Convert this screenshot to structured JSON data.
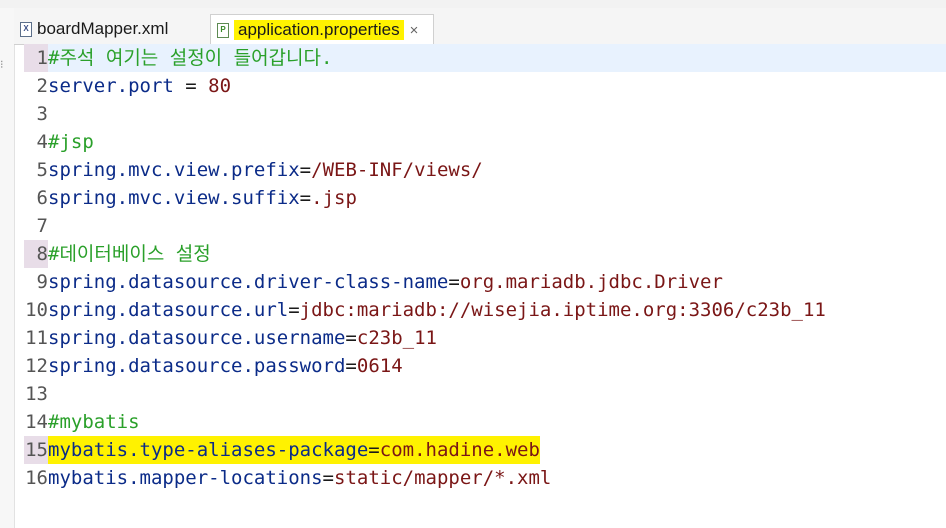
{
  "tabs": [
    {
      "label": "boardMapper.xml",
      "icon": "xml-file-icon",
      "active": false
    },
    {
      "label": "application.properties",
      "icon": "properties-file-icon",
      "active": true,
      "close": "×"
    }
  ],
  "editor": {
    "lines": [
      {
        "num": "1",
        "parts": [
          {
            "t": "#주석 여기는 설정이 들어갑니다.",
            "c": "comment"
          }
        ]
      },
      {
        "num": "2",
        "parts": [
          {
            "t": "server.port",
            "c": "key"
          },
          {
            "t": " = ",
            "c": "op"
          },
          {
            "t": "80",
            "c": "val"
          }
        ]
      },
      {
        "num": "3",
        "parts": []
      },
      {
        "num": "4",
        "parts": [
          {
            "t": "#jsp",
            "c": "comment"
          }
        ]
      },
      {
        "num": "5",
        "parts": [
          {
            "t": "spring.mvc.view.prefix",
            "c": "key"
          },
          {
            "t": "=",
            "c": "op"
          },
          {
            "t": "/WEB-INF/views/",
            "c": "val"
          }
        ]
      },
      {
        "num": "6",
        "parts": [
          {
            "t": "spring.mvc.view.suffix",
            "c": "key"
          },
          {
            "t": "=",
            "c": "op"
          },
          {
            "t": ".jsp",
            "c": "val"
          }
        ]
      },
      {
        "num": "7",
        "parts": []
      },
      {
        "num": "8",
        "parts": [
          {
            "t": "#데이터베이스 설정",
            "c": "comment"
          }
        ]
      },
      {
        "num": "9",
        "parts": [
          {
            "t": "spring.datasource.driver-class-name",
            "c": "key"
          },
          {
            "t": "=",
            "c": "op"
          },
          {
            "t": "org.mariadb.jdbc.Driver",
            "c": "val"
          }
        ]
      },
      {
        "num": "10",
        "parts": [
          {
            "t": "spring.datasource.url",
            "c": "key"
          },
          {
            "t": "=",
            "c": "op"
          },
          {
            "t": "jdbc:mariadb://wisejia.iptime.org:3306/c23b_11",
            "c": "val"
          }
        ]
      },
      {
        "num": "11",
        "parts": [
          {
            "t": "spring.datasource.username",
            "c": "key"
          },
          {
            "t": "=",
            "c": "op"
          },
          {
            "t": "c23b_11",
            "c": "val"
          }
        ]
      },
      {
        "num": "12",
        "parts": [
          {
            "t": "spring.datasource.password",
            "c": "key"
          },
          {
            "t": "=",
            "c": "op"
          },
          {
            "t": "0614",
            "c": "val"
          }
        ]
      },
      {
        "num": "13",
        "parts": []
      },
      {
        "num": "14",
        "parts": [
          {
            "t": "#mybatis",
            "c": "comment"
          }
        ]
      },
      {
        "num": "15",
        "parts": [
          {
            "t": "mybatis.type-aliases-package",
            "c": "key"
          },
          {
            "t": "=",
            "c": "op"
          },
          {
            "t": "com.hadine.web",
            "c": "val"
          }
        ]
      },
      {
        "num": "16",
        "parts": [
          {
            "t": "mybatis.mapper-locations",
            "c": "key"
          },
          {
            "t": "=",
            "c": "op"
          },
          {
            "t": "static/mapper/*.xml",
            "c": "val"
          }
        ]
      }
    ]
  },
  "colors": {
    "highlight": "#fff200",
    "key": "#0b2b88",
    "value": "#7a1616",
    "comment": "#2aa02a"
  }
}
